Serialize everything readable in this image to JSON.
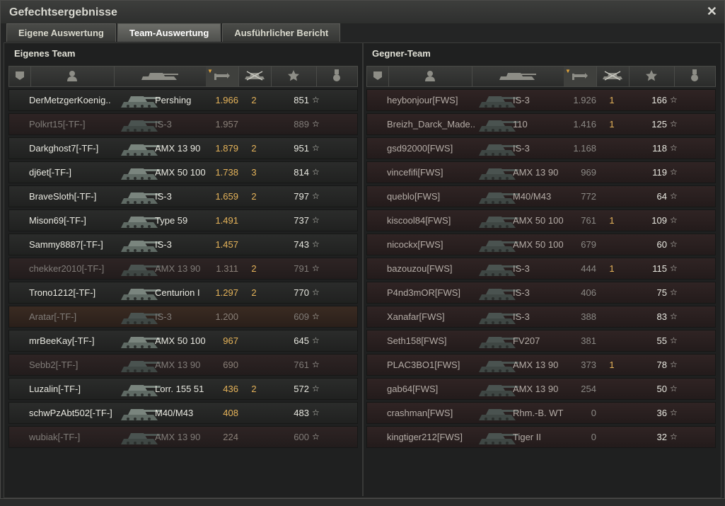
{
  "window": {
    "title": "Gefechtsergebnisse",
    "close_label": "✕"
  },
  "tabs": [
    {
      "label": "Eigene Auswertung",
      "active": false
    },
    {
      "label": "Team-Auswertung",
      "active": true
    },
    {
      "label": "Ausführlicher Bericht",
      "active": false
    }
  ],
  "own_team": {
    "title": "Eigenes Team",
    "rows": [
      {
        "name": "DerMetzgerKoenig..",
        "tank": "Pershing",
        "score": "1.966",
        "kills": "2",
        "xp": "851",
        "dead": false,
        "self": false
      },
      {
        "name": "Polkrt15[-TF-]",
        "tank": "IS-3",
        "score": "1.957",
        "kills": "",
        "xp": "889",
        "dead": true,
        "self": false
      },
      {
        "name": "Darkghost7[-TF-]",
        "tank": "AMX 13 90",
        "score": "1.879",
        "kills": "2",
        "xp": "951",
        "dead": false,
        "self": false
      },
      {
        "name": "dj6et[-TF-]",
        "tank": "AMX 50 100",
        "score": "1.738",
        "kills": "3",
        "xp": "814",
        "dead": false,
        "self": false
      },
      {
        "name": "BraveSloth[-TF-]",
        "tank": "IS-3",
        "score": "1.659",
        "kills": "2",
        "xp": "797",
        "dead": false,
        "self": false
      },
      {
        "name": "Mison69[-TF-]",
        "tank": "Type 59",
        "score": "1.491",
        "kills": "",
        "xp": "737",
        "dead": false,
        "self": false
      },
      {
        "name": "Sammy8887[-TF-]",
        "tank": "IS-3",
        "score": "1.457",
        "kills": "",
        "xp": "743",
        "dead": false,
        "self": false
      },
      {
        "name": "chekker2010[-TF-]",
        "tank": "AMX 13 90",
        "score": "1.311",
        "kills": "2",
        "xp": "791",
        "dead": true,
        "self": false
      },
      {
        "name": "Trono1212[-TF-]",
        "tank": "Centurion I",
        "score": "1.297",
        "kills": "2",
        "xp": "770",
        "dead": false,
        "self": false
      },
      {
        "name": "Aratar[-TF-]",
        "tank": "IS-3",
        "score": "1.200",
        "kills": "",
        "xp": "609",
        "dead": true,
        "self": true
      },
      {
        "name": "mrBeeKay[-TF-]",
        "tank": "AMX 50 100",
        "score": "967",
        "kills": "",
        "xp": "645",
        "dead": false,
        "self": false
      },
      {
        "name": "Sebb2[-TF-]",
        "tank": "AMX 13 90",
        "score": "690",
        "kills": "",
        "xp": "761",
        "dead": true,
        "self": false
      },
      {
        "name": "Luzalin[-TF-]",
        "tank": "Lorr. 155 51",
        "score": "436",
        "kills": "2",
        "xp": "572",
        "dead": false,
        "self": false
      },
      {
        "name": "schwPzAbt502[-TF-]",
        "tank": "M40/M43",
        "score": "408",
        "kills": "",
        "xp": "483",
        "dead": false,
        "self": false
      },
      {
        "name": "wubiak[-TF-]",
        "tank": "AMX 13 90",
        "score": "224",
        "kills": "",
        "xp": "600",
        "dead": true,
        "self": false
      }
    ]
  },
  "enemy_team": {
    "title": "Gegner-Team",
    "rows": [
      {
        "name": "heybonjour[FWS]",
        "tank": "IS-3",
        "score": "1.926",
        "kills": "1",
        "xp": "166"
      },
      {
        "name": "Breizh_Darck_Made..",
        "tank": "110",
        "score": "1.416",
        "kills": "1",
        "xp": "125"
      },
      {
        "name": "gsd92000[FWS]",
        "tank": "IS-3",
        "score": "1.168",
        "kills": "",
        "xp": "118"
      },
      {
        "name": "vincefifi[FWS]",
        "tank": "AMX 13 90",
        "score": "969",
        "kills": "",
        "xp": "119"
      },
      {
        "name": "queblo[FWS]",
        "tank": "M40/M43",
        "score": "772",
        "kills": "",
        "xp": "64"
      },
      {
        "name": "kiscool84[FWS]",
        "tank": "AMX 50 100",
        "score": "761",
        "kills": "1",
        "xp": "109"
      },
      {
        "name": "nicockx[FWS]",
        "tank": "AMX 50 100",
        "score": "679",
        "kills": "",
        "xp": "60"
      },
      {
        "name": "bazouzou[FWS]",
        "tank": "IS-3",
        "score": "444",
        "kills": "1",
        "xp": "115"
      },
      {
        "name": "P4nd3mOR[FWS]",
        "tank": "IS-3",
        "score": "406",
        "kills": "",
        "xp": "75"
      },
      {
        "name": "Xanafar[FWS]",
        "tank": "IS-3",
        "score": "388",
        "kills": "",
        "xp": "83"
      },
      {
        "name": "Seth158[FWS]",
        "tank": "FV207",
        "score": "381",
        "kills": "",
        "xp": "55"
      },
      {
        "name": "PLAC3BO1[FWS]",
        "tank": "AMX 13 90",
        "score": "373",
        "kills": "1",
        "xp": "78"
      },
      {
        "name": "gab64[FWS]",
        "tank": "AMX 13 90",
        "score": "254",
        "kills": "",
        "xp": "50"
      },
      {
        "name": "crashman[FWS]",
        "tank": "Rhm.-B. WT",
        "score": "0",
        "kills": "",
        "xp": "36"
      },
      {
        "name": "kingtiger212[FWS]",
        "tank": "Tiger II",
        "score": "0",
        "kills": "",
        "xp": "32"
      }
    ]
  },
  "columns": [
    "squad-icon",
    "player-icon",
    "tank-icon",
    "damage-icon",
    "kills-icon",
    "xp-icon",
    "medal-icon"
  ],
  "colors": {
    "accent": "#e6b45a",
    "dead_row": "#2e2424",
    "self_row": "#3a2b22"
  }
}
